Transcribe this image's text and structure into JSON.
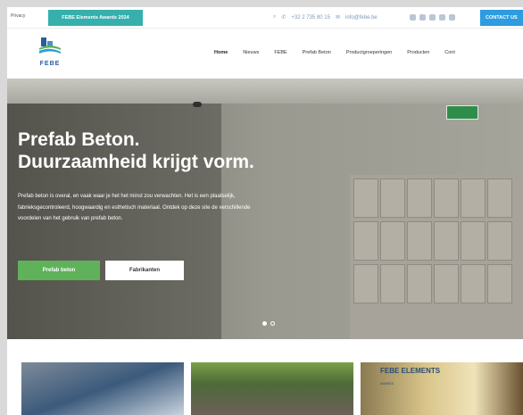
{
  "topbar": {
    "left_text": "Privacy",
    "award": "FEBE Elements Awards 2024",
    "contact_phone": "+32 2 735 80 15",
    "contact_email": "info@febe.be",
    "cta": "CONTACT US"
  },
  "logo": {
    "text": "FEBE"
  },
  "nav": {
    "items": [
      {
        "label": "Home",
        "active": true
      },
      {
        "label": "Nieuws"
      },
      {
        "label": "FEBE"
      },
      {
        "label": "Prefab Beton"
      },
      {
        "label": "Productgroeperingen"
      },
      {
        "label": "Producten"
      },
      {
        "label": "Cont"
      }
    ]
  },
  "hero": {
    "title_line1": "Prefab Beton.",
    "title_line2": "Duurzaamheid krijgt vorm.",
    "lead": "Prefab beton is overal, en vaak waar je het het minst zou verwachten. Het is een plaatselijk, fabrieksgecontroleerd, hoogwaardig en esthetisch materiaal. Ontdek op deze site de verschillende voordelen van het gebruik van prefab beton.",
    "btn_primary": "Prefab beton",
    "btn_secondary": "Fabrikanten",
    "slide_count": 2,
    "slide_active": 1,
    "exit_sign": "🏃→"
  },
  "cards": {
    "card3_title": "FEBE ELEMENTS",
    "card3_sub": "AWARDS"
  },
  "colors": {
    "teal": "#36b0ac",
    "blue": "#2d9ce0",
    "green": "#5fb25a"
  }
}
